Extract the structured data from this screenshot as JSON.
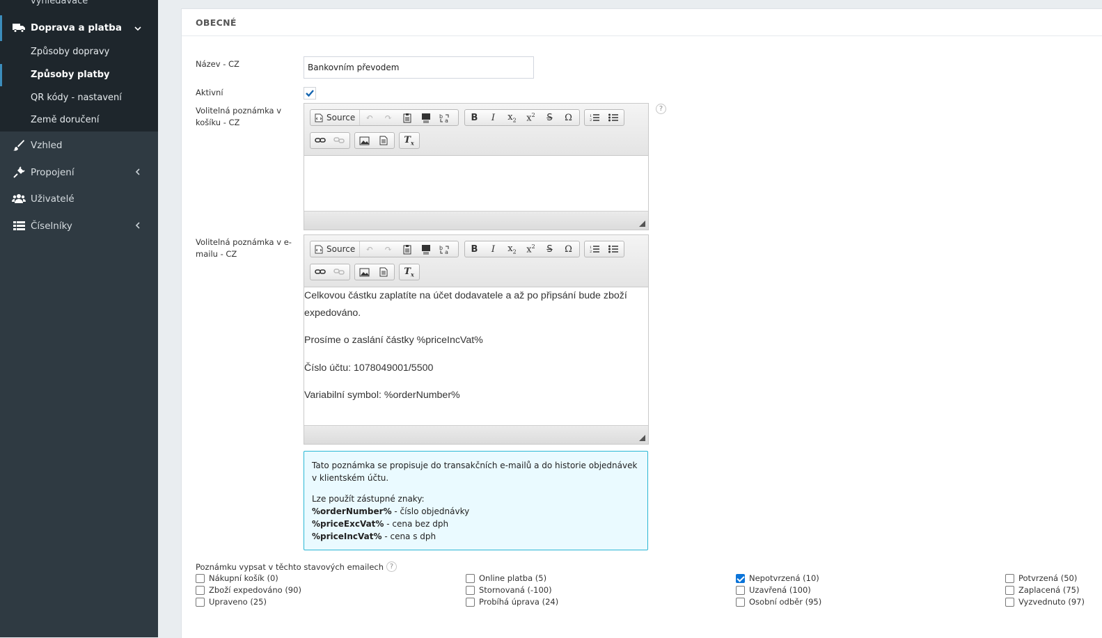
{
  "sidebar": {
    "cut_item": "vyhledávače",
    "group": {
      "label": "Doprava a platba"
    },
    "subitems": [
      "Způsoby dopravy",
      "Způsoby platby",
      "QR kódy - nastavení",
      "Země doručení"
    ],
    "items": [
      {
        "label": "Vzhled",
        "icon": "brush-icon"
      },
      {
        "label": "Propojení",
        "icon": "plug-icon"
      },
      {
        "label": "Uživatelé",
        "icon": "users-icon"
      },
      {
        "label": "Číselníky",
        "icon": "table-icon"
      }
    ]
  },
  "form": {
    "section_title": "OBECNÉ",
    "name_label": "Název - CZ",
    "name_value": "Bankovním převodem",
    "active_label": "Aktivní",
    "active_checked": true,
    "cart_note_label": "Volitelná poznámka v košíku - CZ",
    "email_note_label": "Volitelná poznámka v e-mailu - CZ",
    "help_mark": "?",
    "toolbar": {
      "source_label": "Source"
    },
    "email_note_paragraphs": [
      "Celkovou částku zaplatíte na účet dodavatele a až po připsání bude zboží expedováno.",
      "Prosíme o zaslání částky %priceIncVat%",
      "Číslo účtu: 1078049001/5500",
      "Variabilní symbol: %orderNumber%"
    ]
  },
  "info": {
    "line1": "Tato poznámka se propisuje do transakčních e-mailů a do historie objednávek v klientském účtu.",
    "placeholders_title": "Lze použít zástupné znaky:",
    "placeholders": [
      {
        "key": "%orderNumber%",
        "desc": " - číslo objednávky"
      },
      {
        "key": "%priceExcVat%",
        "desc": " - cena bez dph"
      },
      {
        "key": "%priceIncVat%",
        "desc": " - cena s dph"
      }
    ]
  },
  "statuses": {
    "label": "Poznámku vypsat v těchto stavových emailech",
    "items": [
      {
        "label": "Nákupní košík (0)",
        "checked": false
      },
      {
        "label": "Zboží expedováno (90)",
        "checked": false
      },
      {
        "label": "Upraveno (25)",
        "checked": false
      },
      {
        "label": "Online platba (5)",
        "checked": false
      },
      {
        "label": "Stornovaná (-100)",
        "checked": false
      },
      {
        "label": "Probíhá úprava (24)",
        "checked": false
      },
      {
        "label": "Nepotvrzená (10)",
        "checked": true
      },
      {
        "label": "Uzavřená (100)",
        "checked": false
      },
      {
        "label": "Osobní odběr (95)",
        "checked": false
      },
      {
        "label": "Potvrzená (50)",
        "checked": false
      },
      {
        "label": "Zaplacená (75)",
        "checked": false
      },
      {
        "label": "Vyzvednuto (97)",
        "checked": false
      }
    ]
  },
  "colors": {
    "sidebar": "#2f3a42",
    "sidebar_sub": "#1e262c",
    "accent": "#3c8dbc",
    "check": "#0b74d9",
    "info_border": "#29b6d4"
  }
}
